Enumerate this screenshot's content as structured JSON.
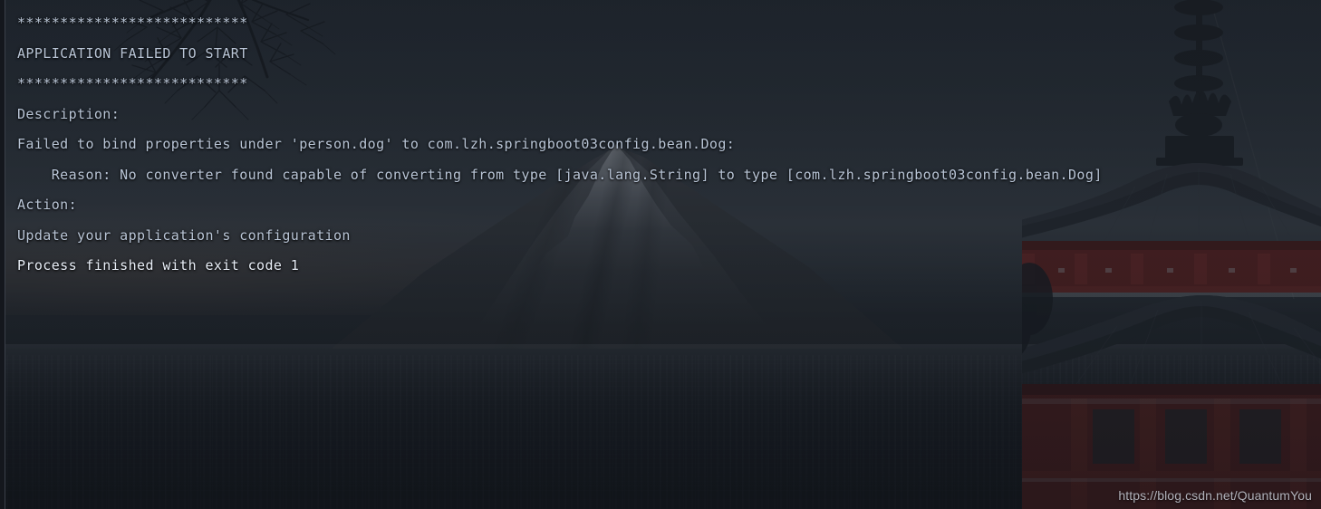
{
  "console": {
    "lines": [
      {
        "text": "***************************",
        "style": "normal"
      },
      {
        "text": "APPLICATION FAILED TO START",
        "style": "normal"
      },
      {
        "text": "***************************",
        "style": "normal"
      },
      {
        "text": "",
        "style": "blank"
      },
      {
        "text": "Description:",
        "style": "normal"
      },
      {
        "text": "",
        "style": "blank"
      },
      {
        "text": "Failed to bind properties under 'person.dog' to com.lzh.springboot03config.bean.Dog:",
        "style": "normal"
      },
      {
        "text": "",
        "style": "blank"
      },
      {
        "text": "    Reason: No converter found capable of converting from type [java.lang.String] to type [com.lzh.springboot03config.bean.Dog]",
        "style": "normal"
      },
      {
        "text": "",
        "style": "blank"
      },
      {
        "text": "Action:",
        "style": "normal"
      },
      {
        "text": "",
        "style": "blank"
      },
      {
        "text": "Update your application's configuration",
        "style": "normal"
      },
      {
        "text": "",
        "style": "blank"
      },
      {
        "text": "",
        "style": "blank"
      },
      {
        "text": "Process finished with exit code 1",
        "style": "bright"
      }
    ],
    "text_color": "#b9c5d6",
    "bright_color": "#e8eef7",
    "background_color": "#2b3039"
  },
  "watermark": {
    "text": "https://blog.csdn.net/QuantumYou"
  },
  "background": {
    "scene": "mount-fuji-with-red-pagoda-at-dusk",
    "sky_color": "#3a424e",
    "mountain_color": "#44484f",
    "snow_color": "#d6dae2",
    "pagoda_red": "#8a2b28",
    "pagoda_roof": "#31363e"
  }
}
